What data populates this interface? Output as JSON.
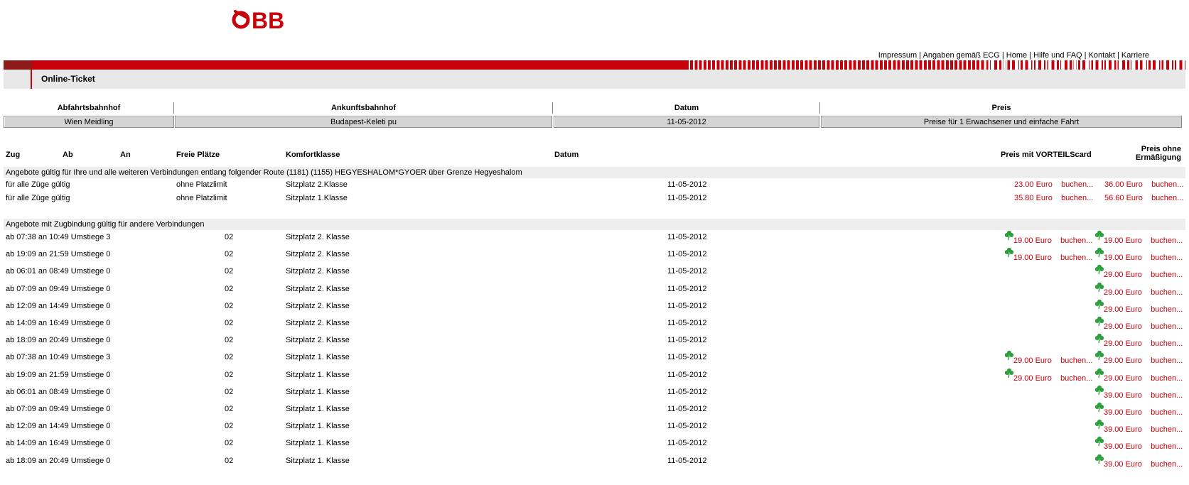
{
  "brand": {
    "logo_text": "ÖBB",
    "accent": "#c8000a",
    "clover_color": "#2e9e3e"
  },
  "toplinks": [
    "Impressum",
    "Angaben gemäß ECG",
    "Home",
    "Hilfe und FAQ",
    "Kontakt",
    "Karriere"
  ],
  "page_title": "Online-Ticket",
  "search": {
    "headers": [
      "Abfahrtsbahnhof",
      "Ankunftsbahnhof",
      "Datum",
      "Preis"
    ],
    "values": [
      "Wien Meidling",
      "Budapest-Keleti pu",
      "11-05-2012",
      "Preise für 1 Erwachsener und einfache Fahrt"
    ]
  },
  "columns": {
    "zug": "Zug",
    "ab": "Ab",
    "an": "An",
    "freie": "Freie Plätze",
    "komfort": "Komfortklasse",
    "datum": "Datum",
    "preis_vorteil": "Preis mit VORTEILScard",
    "preis_ohne_1": "Preis ohne",
    "preis_ohne_2": "Ermäßigung"
  },
  "section1": {
    "title": "Angebote gültig für Ihre und alle weiteren Verbindungen entlang folgender Route (1181) (1155) HEGYESHALOM*GYOER über Grenze Hegyeshalom",
    "rows": [
      {
        "zug": "für alle Züge gültig",
        "platz": "ohne Platzlimit",
        "klasse": "Sitzplatz 2.Klasse",
        "datum": "11-05-2012",
        "p1": "23.00 Euro",
        "p2": "36.00 Euro"
      },
      {
        "zug": "für alle Züge gültig",
        "platz": "ohne Platzlimit",
        "klasse": "Sitzplatz 1.Klasse",
        "datum": "11-05-2012",
        "p1": "35.80 Euro",
        "p2": "56.60 Euro"
      }
    ]
  },
  "buchen": "buchen...",
  "section2": {
    "title": "Angebote mit Zugbindung gültig für andere Verbindungen",
    "rows": [
      {
        "zug": "ab 07:38 an 10:49 Umstiege 3",
        "platz": "02",
        "klasse": "Sitzplatz 2. Klasse",
        "datum": "11-05-2012",
        "p1": "19.00 Euro",
        "p2": "19.00 Euro"
      },
      {
        "zug": "ab 19:09 an 21:59 Umstiege 0",
        "platz": "02",
        "klasse": "Sitzplatz 2. Klasse",
        "datum": "11-05-2012",
        "p1": "19.00 Euro",
        "p2": "19.00 Euro"
      },
      {
        "zug": "ab 06:01 an 08:49 Umstiege 0",
        "platz": "02",
        "klasse": "Sitzplatz 2. Klasse",
        "datum": "11-05-2012",
        "p1": "",
        "p2": "29.00 Euro"
      },
      {
        "zug": "ab 07:09 an 09:49 Umstiege 0",
        "platz": "02",
        "klasse": "Sitzplatz 2. Klasse",
        "datum": "11-05-2012",
        "p1": "",
        "p2": "29.00 Euro"
      },
      {
        "zug": "ab 12:09 an 14:49 Umstiege 0",
        "platz": "02",
        "klasse": "Sitzplatz 2. Klasse",
        "datum": "11-05-2012",
        "p1": "",
        "p2": "29.00 Euro"
      },
      {
        "zug": "ab 14:09 an 16:49 Umstiege 0",
        "platz": "02",
        "klasse": "Sitzplatz 2. Klasse",
        "datum": "11-05-2012",
        "p1": "",
        "p2": "29.00 Euro"
      },
      {
        "zug": "ab 18:09 an 20:49 Umstiege 0",
        "platz": "02",
        "klasse": "Sitzplatz 2. Klasse",
        "datum": "11-05-2012",
        "p1": "",
        "p2": "29.00 Euro"
      },
      {
        "zug": "ab 07:38 an 10:49 Umstiege 3",
        "platz": "02",
        "klasse": "Sitzplatz 1. Klasse",
        "datum": "11-05-2012",
        "p1": "29.00 Euro",
        "p2": "29.00 Euro"
      },
      {
        "zug": "ab 19:09 an 21:59 Umstiege 0",
        "platz": "02",
        "klasse": "Sitzplatz 1. Klasse",
        "datum": "11-05-2012",
        "p1": "29.00 Euro",
        "p2": "29.00 Euro"
      },
      {
        "zug": "ab 06:01 an 08:49 Umstiege 0",
        "platz": "02",
        "klasse": "Sitzplatz 1. Klasse",
        "datum": "11-05-2012",
        "p1": "",
        "p2": "39.00 Euro"
      },
      {
        "zug": "ab 07:09 an 09:49 Umstiege 0",
        "platz": "02",
        "klasse": "Sitzplatz 1. Klasse",
        "datum": "11-05-2012",
        "p1": "",
        "p2": "39.00 Euro"
      },
      {
        "zug": "ab 12:09 an 14:49 Umstiege 0",
        "platz": "02",
        "klasse": "Sitzplatz 1. Klasse",
        "datum": "11-05-2012",
        "p1": "",
        "p2": "39.00 Euro"
      },
      {
        "zug": "ab 14:09 an 16:49 Umstiege 0",
        "platz": "02",
        "klasse": "Sitzplatz 1. Klasse",
        "datum": "11-05-2012",
        "p1": "",
        "p2": "39.00 Euro"
      },
      {
        "zug": "ab 18:09 an 20:49 Umstiege 0",
        "platz": "02",
        "klasse": "Sitzplatz 1. Klasse",
        "datum": "11-05-2012",
        "p1": "",
        "p2": "39.00 Euro"
      }
    ]
  }
}
